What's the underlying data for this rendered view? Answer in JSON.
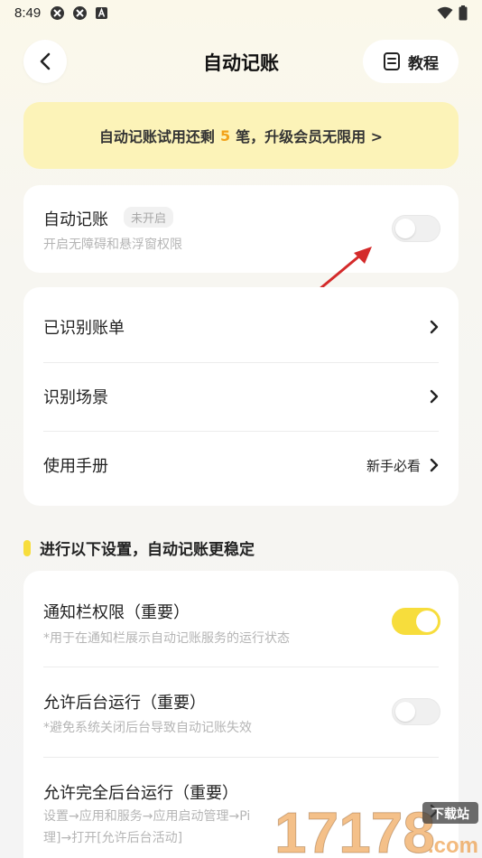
{
  "status_bar": {
    "time": "8:49"
  },
  "header": {
    "title": "自动记账",
    "tutorial_label": "教程"
  },
  "banner": {
    "prefix": "自动记账试用还剩",
    "count": "5",
    "suffix": "笔，升级会员无限用 >"
  },
  "auto_card": {
    "title": "自动记账",
    "badge": "未开启",
    "subtitle": "开启无障碍和悬浮窗权限",
    "enabled": false
  },
  "menu": {
    "items": [
      {
        "label": "已识别账单",
        "extra": ""
      },
      {
        "label": "识别场景",
        "extra": ""
      },
      {
        "label": "使用手册",
        "extra": "新手必看"
      }
    ]
  },
  "section": {
    "title": "进行以下设置，自动记账更稳定"
  },
  "settings": {
    "items": [
      {
        "title": "通知栏权限（重要）",
        "subtitle": "*用于在通知栏展示自动记账服务的运行状态",
        "enabled": true
      },
      {
        "title": "允许后台运行（重要）",
        "subtitle": "*避免系统关闭后台导致自动记账失效",
        "enabled": false
      },
      {
        "title": "允许完全后台运行（重要）",
        "subtitle": "设置→应用和服务→应用启动管理→Pi",
        "subtitle2": "理]→打开[允许后台活动]"
      }
    ]
  },
  "watermark": {
    "text": "17178",
    "site": ".com",
    "badge": "下载站"
  },
  "colors": {
    "accent": "#f7dd3c",
    "banner_bg": "#fcf3b8",
    "count": "#f2a21a"
  }
}
